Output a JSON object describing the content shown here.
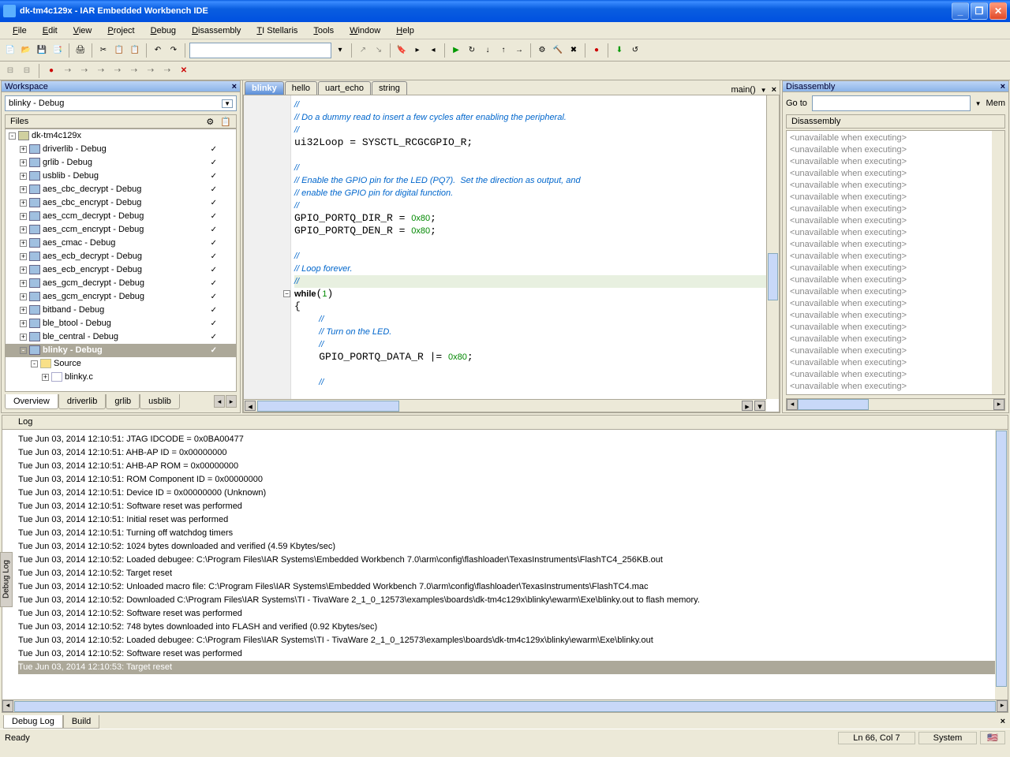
{
  "title": "dk-tm4c129x - IAR Embedded Workbench IDE",
  "menu": [
    "File",
    "Edit",
    "View",
    "Project",
    "Debug",
    "Disassembly",
    "TI Stellaris",
    "Tools",
    "Window",
    "Help"
  ],
  "workspace": {
    "title": "Workspace",
    "config": "blinky - Debug",
    "filesHdr": "Files",
    "tree": [
      {
        "l": 0,
        "t": "wk",
        "exp": "-",
        "n": "dk-tm4c129x",
        "c": ""
      },
      {
        "l": 1,
        "t": "pr",
        "exp": "+",
        "n": "driverlib - Debug",
        "c": "✓"
      },
      {
        "l": 1,
        "t": "pr",
        "exp": "+",
        "n": "grlib - Debug",
        "c": "✓"
      },
      {
        "l": 1,
        "t": "pr",
        "exp": "+",
        "n": "usblib - Debug",
        "c": "✓"
      },
      {
        "l": 1,
        "t": "pr",
        "exp": "+",
        "n": "aes_cbc_decrypt - Debug",
        "c": "✓"
      },
      {
        "l": 1,
        "t": "pr",
        "exp": "+",
        "n": "aes_cbc_encrypt - Debug",
        "c": "✓"
      },
      {
        "l": 1,
        "t": "pr",
        "exp": "+",
        "n": "aes_ccm_decrypt - Debug",
        "c": "✓"
      },
      {
        "l": 1,
        "t": "pr",
        "exp": "+",
        "n": "aes_ccm_encrypt - Debug",
        "c": "✓"
      },
      {
        "l": 1,
        "t": "pr",
        "exp": "+",
        "n": "aes_cmac - Debug",
        "c": "✓"
      },
      {
        "l": 1,
        "t": "pr",
        "exp": "+",
        "n": "aes_ecb_decrypt - Debug",
        "c": "✓"
      },
      {
        "l": 1,
        "t": "pr",
        "exp": "+",
        "n": "aes_ecb_encrypt - Debug",
        "c": "✓"
      },
      {
        "l": 1,
        "t": "pr",
        "exp": "+",
        "n": "aes_gcm_decrypt - Debug",
        "c": "✓"
      },
      {
        "l": 1,
        "t": "pr",
        "exp": "+",
        "n": "aes_gcm_encrypt - Debug",
        "c": "✓"
      },
      {
        "l": 1,
        "t": "pr",
        "exp": "+",
        "n": "bitband - Debug",
        "c": "✓"
      },
      {
        "l": 1,
        "t": "pr",
        "exp": "+",
        "n": "ble_btool - Debug",
        "c": "✓"
      },
      {
        "l": 1,
        "t": "pr",
        "exp": "+",
        "n": "ble_central - Debug",
        "c": "✓"
      },
      {
        "l": 1,
        "t": "pr",
        "exp": "-",
        "n": "blinky - Debug",
        "c": "✓",
        "sel": true
      },
      {
        "l": 2,
        "t": "fd",
        "exp": "-",
        "n": "Source",
        "c": ""
      },
      {
        "l": 3,
        "t": "fl",
        "exp": "+",
        "n": "blinky.c",
        "c": ""
      }
    ],
    "tabs": [
      "Overview",
      "driverlib",
      "grlib",
      "usblib"
    ]
  },
  "editor": {
    "tabs": [
      "blinky",
      "hello",
      "uart_echo",
      "string"
    ],
    "fn": "main()"
  },
  "disasm": {
    "title": "Disassembly",
    "goto": "Go to",
    "mem": "Mem",
    "hdr": "Disassembly",
    "line": "<unavailable when executing>"
  },
  "log": {
    "hdr": "Log",
    "rows": [
      "Tue Jun 03, 2014 12:10:51: JTAG IDCODE       = 0x0BA00477",
      "Tue Jun 03, 2014 12:10:51: AHB-AP ID         = 0x00000000",
      "Tue Jun 03, 2014 12:10:51: AHB-AP ROM       = 0x00000000",
      "Tue Jun 03, 2014 12:10:51: ROM Component ID = 0x00000000",
      "Tue Jun 03, 2014 12:10:51: Device ID        = 0x00000000 (Unknown)",
      "Tue Jun 03, 2014 12:10:51: Software reset was performed",
      "Tue Jun 03, 2014 12:10:51: Initial reset was performed",
      "Tue Jun 03, 2014 12:10:51: Turning off watchdog timers",
      "Tue Jun 03, 2014 12:10:52: 1024 bytes downloaded and verified (4.59 Kbytes/sec)",
      "Tue Jun 03, 2014 12:10:52: Loaded debugee: C:\\Program Files\\IAR Systems\\Embedded Workbench 7.0\\arm\\config\\flashloader\\TexasInstruments\\FlashTC4_256KB.out",
      "Tue Jun 03, 2014 12:10:52: Target reset",
      "Tue Jun 03, 2014 12:10:52: Unloaded macro file: C:\\Program Files\\IAR Systems\\Embedded Workbench 7.0\\arm\\config\\flashloader\\TexasInstruments\\FlashTC4.mac",
      "Tue Jun 03, 2014 12:10:52: Downloaded C:\\Program Files\\IAR Systems\\TI - TivaWare 2_1_0_12573\\examples\\boards\\dk-tm4c129x\\blinky\\ewarm\\Exe\\blinky.out to flash memory.",
      "Tue Jun 03, 2014 12:10:52: Software reset was performed",
      "Tue Jun 03, 2014 12:10:52: 748 bytes downloaded into FLASH and verified (0.92 Kbytes/sec)",
      "Tue Jun 03, 2014 12:10:52: Loaded debugee: C:\\Program Files\\IAR Systems\\TI - TivaWare 2_1_0_12573\\examples\\boards\\dk-tm4c129x\\blinky\\ewarm\\Exe\\blinky.out",
      "Tue Jun 03, 2014 12:10:52: Software reset was performed",
      "Tue Jun 03, 2014 12:10:53: Target reset"
    ]
  },
  "btabs": [
    "Debug Log",
    "Build"
  ],
  "status": {
    "ready": "Ready",
    "pos": "Ln 66, Col 7",
    "sys": "System"
  }
}
